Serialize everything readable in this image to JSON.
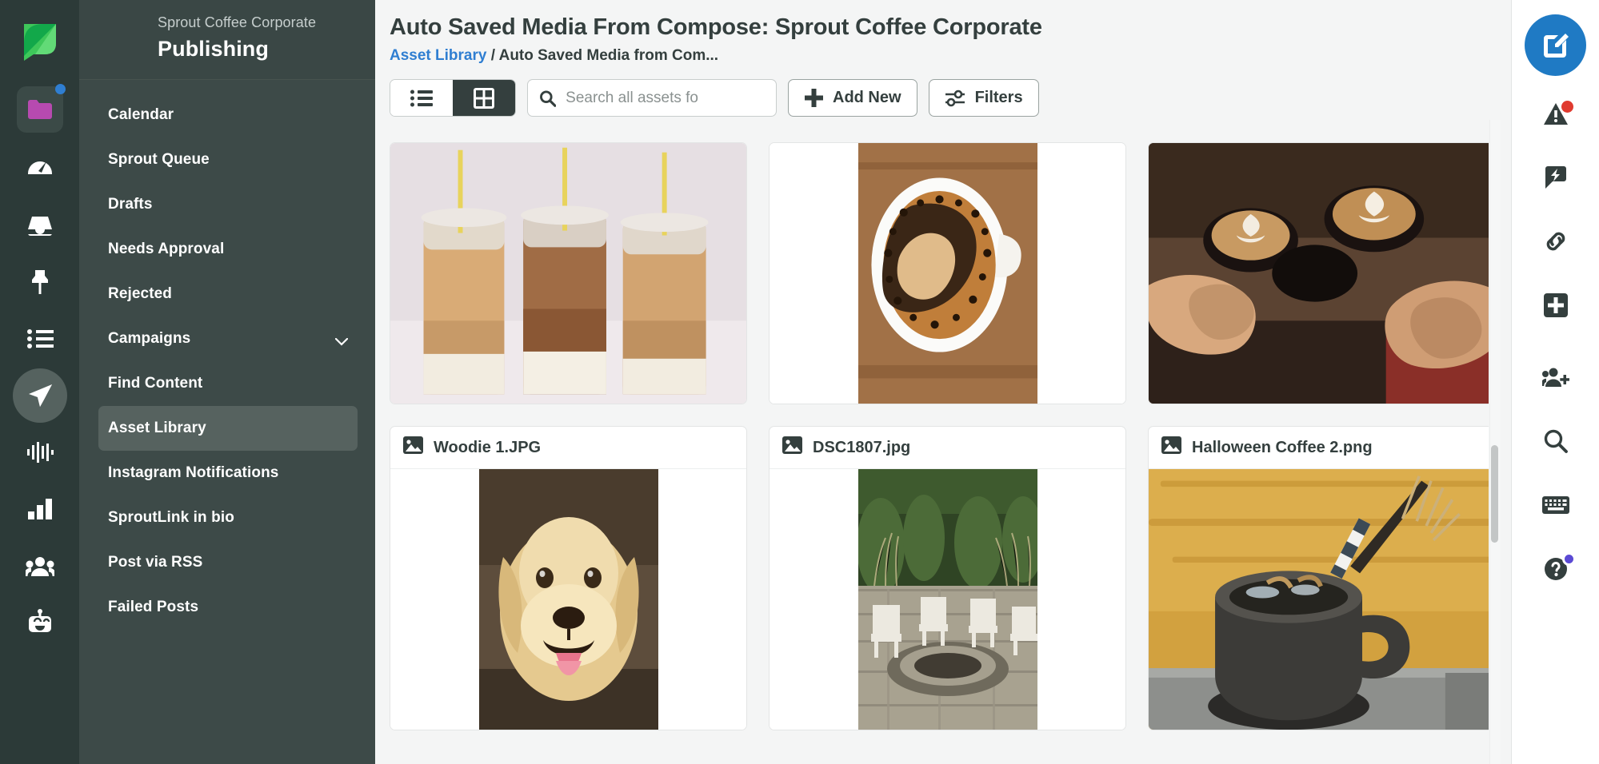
{
  "brand": {
    "logo": "sprout-leaf-logo",
    "accent": "#1f7ac4",
    "dark": "#2c3a38"
  },
  "left_rail": {
    "items": [
      {
        "icon": "folder-icon",
        "name": "assets-tile",
        "badge": "blue-dot"
      },
      {
        "icon": "speedometer-icon",
        "name": "dashboard"
      },
      {
        "icon": "inbox-icon",
        "name": "smart-inbox"
      },
      {
        "icon": "pin-icon",
        "name": "pinned"
      },
      {
        "icon": "list-icon",
        "name": "tasks"
      },
      {
        "icon": "paper-plane-icon",
        "name": "publishing",
        "active": true
      },
      {
        "icon": "sound-wave-icon",
        "name": "listening"
      },
      {
        "icon": "bar-chart-icon",
        "name": "reports"
      },
      {
        "icon": "people-group-icon",
        "name": "employee-advocacy"
      },
      {
        "icon": "robot-icon",
        "name": "bots"
      }
    ]
  },
  "sidebar": {
    "account_name": "Sprout Coffee Corporate",
    "section_title": "Publishing",
    "items": [
      {
        "label": "Calendar",
        "active": false
      },
      {
        "label": "Sprout Queue",
        "active": false
      },
      {
        "label": "Drafts",
        "active": false
      },
      {
        "label": "Needs Approval",
        "active": false
      },
      {
        "label": "Rejected",
        "active": false
      },
      {
        "label": "Campaigns",
        "active": false,
        "expandable": true
      },
      {
        "label": "Find Content",
        "active": false
      },
      {
        "label": "Asset Library",
        "active": true
      },
      {
        "label": "Instagram Notifications",
        "active": false
      },
      {
        "label": "SproutLink in bio",
        "active": false
      },
      {
        "label": "Post via RSS",
        "active": false
      },
      {
        "label": "Failed Posts",
        "active": false
      }
    ]
  },
  "main": {
    "title": "Auto Saved Media From Compose: Sprout Coffee Corporate",
    "breadcrumb": {
      "root": "Asset Library",
      "separator": "/",
      "current": "Auto Saved Media from Com..."
    },
    "toolbar": {
      "view_list_label": "list-view",
      "view_grid_label": "grid-view",
      "active_view": "grid",
      "search_placeholder": "Search all assets fo",
      "search_value": "",
      "add_new_label": "Add New",
      "filters_label": "Filters"
    },
    "assets": [
      {
        "name": "",
        "has_name": false,
        "art": "iced-coffee-jars",
        "fit": "cover"
      },
      {
        "name": "",
        "has_name": false,
        "art": "black-coffee-cup",
        "fit": "contain"
      },
      {
        "name": "",
        "has_name": false,
        "art": "latte-cheers-hands",
        "fit": "cover"
      },
      {
        "name": "Woodie 1.JPG",
        "has_name": true,
        "art": "golden-retriever-dog",
        "fit": "contain"
      },
      {
        "name": "DSC1807.jpg",
        "has_name": true,
        "art": "patio-fire-pit-chairs",
        "fit": "contain"
      },
      {
        "name": "Halloween Coffee 2.png",
        "has_name": true,
        "art": "halloween-coffee-mug",
        "fit": "cover"
      }
    ]
  },
  "right_rail": {
    "items": [
      {
        "icon": "compose-pencil-icon",
        "name": "compose-button"
      },
      {
        "icon": "warning-triangle-icon",
        "name": "alerts",
        "badge": "red"
      },
      {
        "icon": "lightning-chat-icon",
        "name": "quick-actions"
      },
      {
        "icon": "link-icon",
        "name": "link-shortener"
      },
      {
        "icon": "plus-square-icon",
        "name": "add-item"
      },
      {
        "icon": "add-people-icon",
        "name": "invite-users"
      },
      {
        "icon": "search-icon",
        "name": "global-search"
      },
      {
        "icon": "keyboard-icon",
        "name": "keyboard-shortcuts"
      },
      {
        "icon": "help-circle-icon",
        "name": "help",
        "badge": "purple"
      }
    ]
  }
}
